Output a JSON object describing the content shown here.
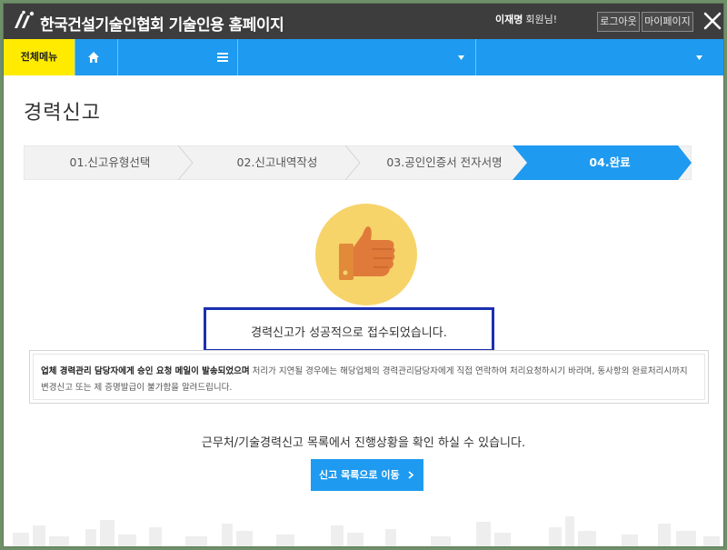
{
  "header": {
    "site_title": "한국건설기술인협회 기술인용 홈페이지",
    "user_name": "이재명",
    "user_suffix": "회원님!",
    "logout_label": "로그아웃",
    "mypage_label": "마이페이지",
    "logo_icon": "kocea-logo-icon",
    "close_icon": "close-icon"
  },
  "nav": {
    "all_menu_label": "전체메뉴",
    "home_icon": "home-icon",
    "menu_icon": "hamburger-icon",
    "dropdown_icon": "caret-down-icon",
    "bar_color": "#1e9af0",
    "all_menu_color": "#ffeb00"
  },
  "page": {
    "title": "경력신고",
    "steps": [
      {
        "label": "01.신고유형선택",
        "active": false
      },
      {
        "label": "02.신고내역작성",
        "active": false
      },
      {
        "label": "03.공인인증서 전자서명",
        "active": false
      },
      {
        "label": "04.완료",
        "active": true
      }
    ],
    "success_message": "경력신고가 성공적으로 접수되었습니다.",
    "notice_strong": "업체 경력관리 담당자에게 승인 요청 메일이 발송되었으며",
    "notice_rest": " 처리가 지연될 경우에는 해당업체의 경력관리담당자에게 직접 연락하여 처리요청하시기 바라며, 동사항의 완료처리시까지 변경신고 또는 제 증명발급이 불가함을 알려드립니다.",
    "track_message": "근무처/기술경력신고 목록에서 진행상황을 확인 하실 수 있습니다.",
    "list_button_label": "신고 목록으로 이동",
    "thumb_icon": "thumbs-up-icon",
    "accent_color": "#1e9af0",
    "highlight_border_color": "#1a2fb0"
  }
}
